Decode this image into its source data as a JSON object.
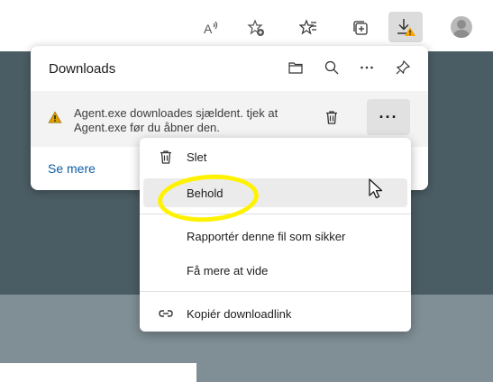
{
  "toolbar": {
    "icons": [
      "read-aloud-icon",
      "add-favorite-icon",
      "favorites-icon",
      "collections-icon",
      "downloads-icon",
      "profile-avatar"
    ],
    "warning_badge_color": "#f7a600"
  },
  "downloads_panel": {
    "title": "Downloads",
    "header_icons": [
      "open-folder-icon",
      "search-icon",
      "more-options-icon",
      "pin-icon"
    ],
    "item": {
      "warning_line1": "Agent.exe downloades sjældent. tjek at",
      "warning_line2": "Agent.exe før du åbner den.",
      "more_label": "···"
    },
    "see_more": "Se mere"
  },
  "context_menu": {
    "delete": "Slet",
    "keep": "Behold",
    "report_safe": "Rapportér denne fil som sikker",
    "learn_more": "Få mere at vide",
    "copy_link": "Kopiér downloadlink"
  },
  "colors": {
    "highlight": "#fff200",
    "link": "#115ea3",
    "warning": "#e0a100"
  }
}
